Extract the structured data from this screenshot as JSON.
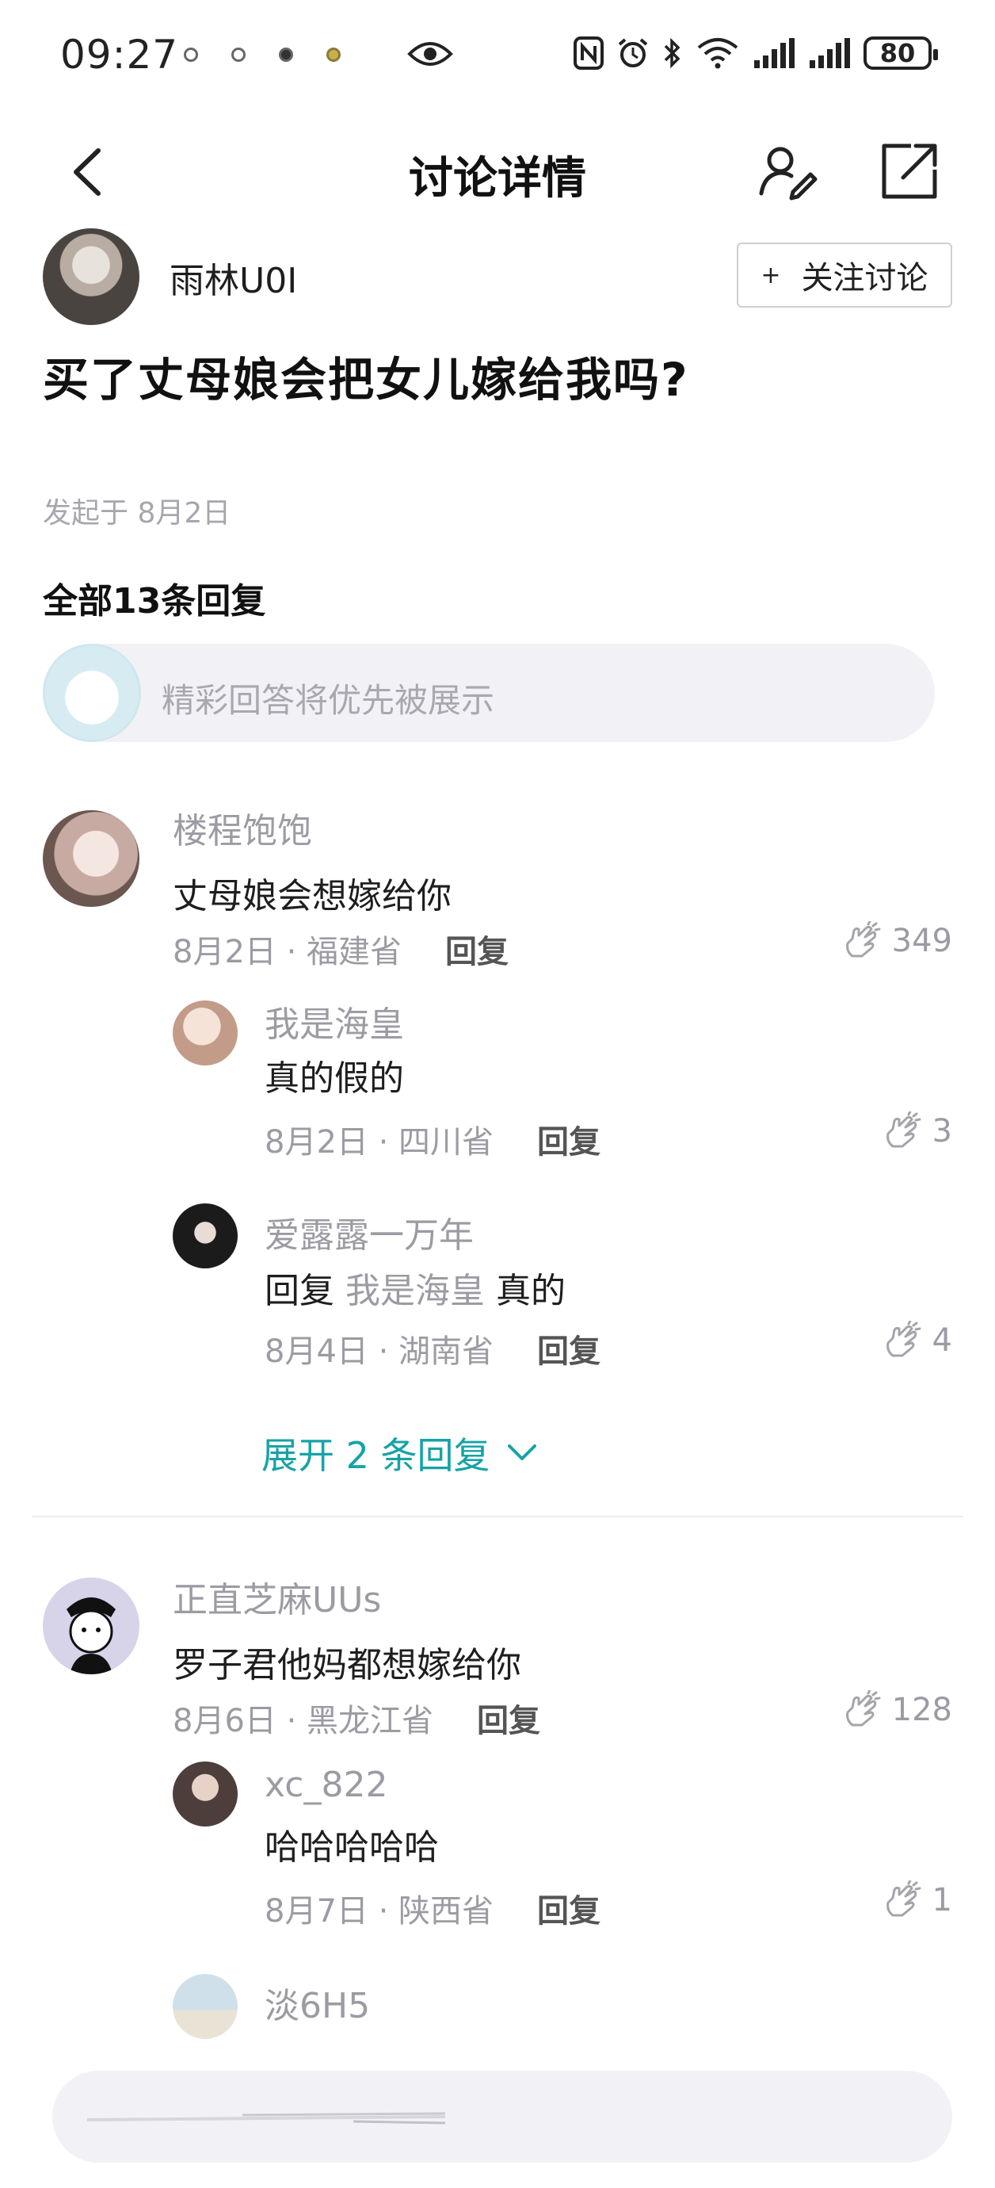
{
  "status_bar": {
    "time": "09:27",
    "battery": "80"
  },
  "nav": {
    "title": "讨论详情"
  },
  "author": {
    "name": "雨林U0I",
    "follow_plus": "+",
    "follow_label": "关注讨论"
  },
  "post": {
    "title": "买了丈母娘会把女儿嫁给我吗?",
    "date": "发起于 8月2日",
    "reply_count": "全部13条回复"
  },
  "input": {
    "placeholder": "精彩回答将优先被展示"
  },
  "reply_label": "回复",
  "comments": [
    {
      "name": "楼程饱饱",
      "text": "丈母娘会想嫁给你",
      "meta": "8月2日 · 福建省",
      "likes": "349",
      "avatar_color": "#d9c9c3",
      "replies": [
        {
          "name": "我是海皇",
          "text": "真的假的",
          "meta": "8月2日 · 四川省",
          "likes": "3",
          "avatar_color": "#e8d4c8"
        },
        {
          "name": "爱露露一万年",
          "reply_prefix": "回复",
          "reply_target": "我是海皇",
          "text": "真的",
          "meta": "8月4日 · 湖南省",
          "likes": "4",
          "avatar_color": "#222222"
        }
      ],
      "expand_label": "展开 2 条回复"
    },
    {
      "name": "正直芝麻UUs",
      "text": "罗子君他妈都想嫁给你",
      "meta": "8月6日 · 黑龙江省",
      "likes": "128",
      "avatar_color": "#d7d3e8",
      "replies": [
        {
          "name": "xc_822",
          "text": "哈哈哈哈哈",
          "meta": "8月7日 · 陕西省",
          "likes": "1",
          "avatar_color": "#5a4a48"
        },
        {
          "name": "淡6H5",
          "avatar_color": "#cfe0ea"
        }
      ]
    }
  ],
  "colors": {
    "accent": "#16a3a6",
    "muted": "#9b9ba3",
    "input_bg": "#f2f2f6"
  }
}
